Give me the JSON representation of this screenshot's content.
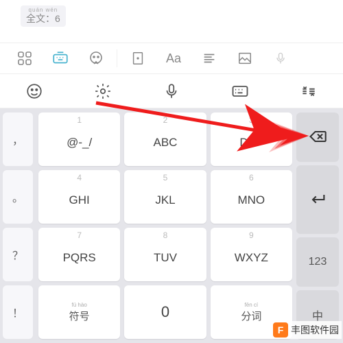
{
  "badge": {
    "pinyin": "quán wén",
    "main": "全文：6"
  },
  "toolbar1": {
    "grid_icon": "grid-icon",
    "keyboard_switch_icon": "keyboard-switch-icon",
    "face_icon": "face-robot-icon",
    "rect_icon": "rect-icon",
    "font_label": "Aa",
    "align_icon": "align-icon",
    "image_icon": "image-icon",
    "mic_icon": "mic-icon"
  },
  "toolbar2": {
    "emoji_icon": "emoji-icon",
    "gear_icon": "gear-icon",
    "mic_icon": "mic-icon",
    "keyboard_icon": "keyboard-icon",
    "lines_icon": "collapse-icon"
  },
  "left_col": {
    "k1": "，",
    "k2": "。",
    "k3": "？",
    "k4": "！"
  },
  "keys": {
    "r1c1": {
      "num": "1",
      "letters": "@-_/"
    },
    "r1c2": {
      "num": "2",
      "letters": "ABC"
    },
    "r1c3": {
      "num": "3",
      "letters": "DEF"
    },
    "r2c1": {
      "num": "4",
      "letters": "GHI"
    },
    "r2c2": {
      "num": "5",
      "letters": "JKL"
    },
    "r2c3": {
      "num": "6",
      "letters": "MNO"
    },
    "r3c1": {
      "num": "7",
      "letters": "PQRS"
    },
    "r3c2": {
      "num": "8",
      "letters": "TUV"
    },
    "r3c3": {
      "num": "9",
      "letters": "WXYZ"
    },
    "r4c1": {
      "pinyin": "fú  hào",
      "ch": "符号"
    },
    "r4c2": {
      "num": "",
      "big": "0"
    },
    "r4c3": {
      "pinyin": "fēn   cí",
      "ch": "分词"
    }
  },
  "right_col": {
    "switch": "123",
    "lang": "中"
  },
  "watermark": {
    "logo": "F",
    "text": "丰图软件园"
  },
  "chart_data": null
}
